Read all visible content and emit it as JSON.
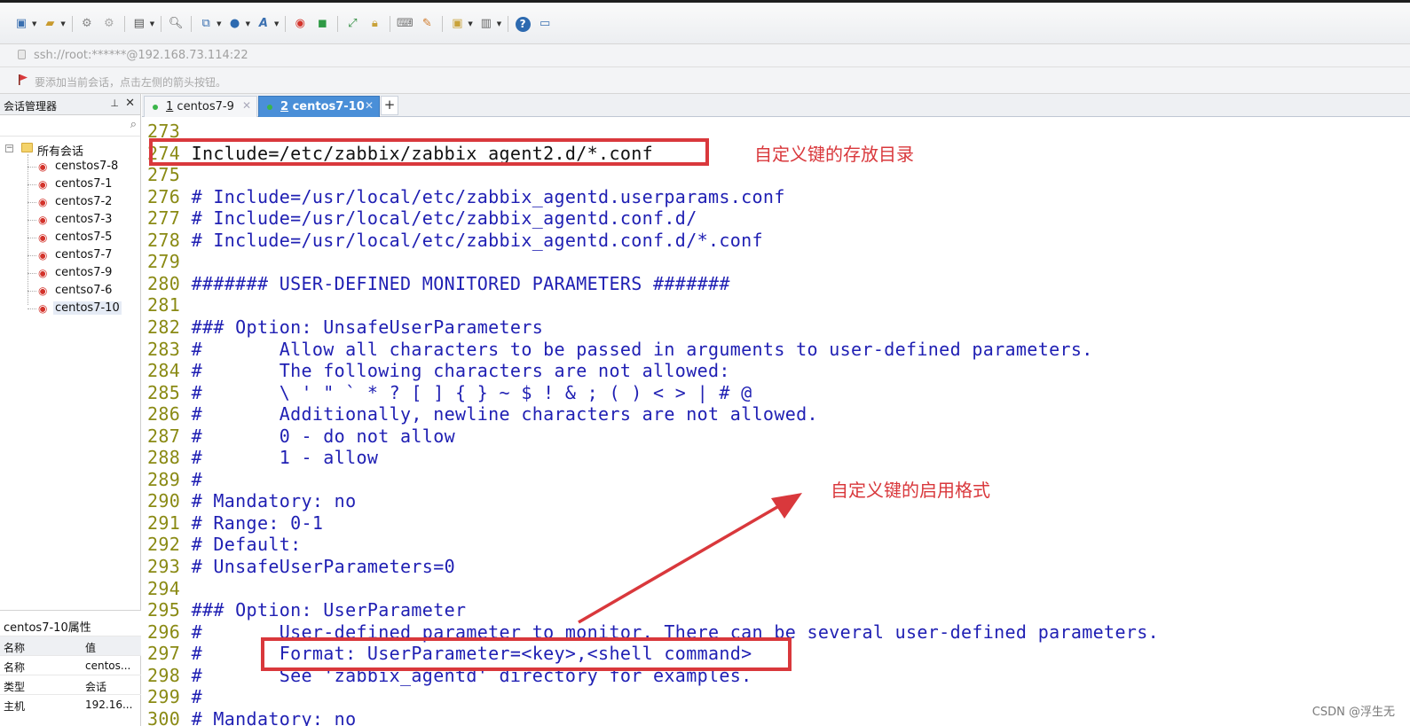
{
  "toolbar": {
    "icons": [
      "new-session-icon",
      "open-folder-icon",
      "connect-icon",
      "disconnect-icon",
      "session-layout-icon",
      "find-icon",
      "copy-paste-icon",
      "globe-icon",
      "font-icon",
      "xftp-icon",
      "xshell-icon",
      "fullscreen-icon",
      "lock-icon",
      "keyboard-icon",
      "highlight-icon",
      "compose-icon",
      "layout-icon",
      "help-icon",
      "chat-icon"
    ]
  },
  "address": {
    "text": "ssh://root:******@192.168.73.114:22"
  },
  "hint": {
    "text": "要添加当前会话，点击左侧的箭头按钮。"
  },
  "sidebar": {
    "title": "会话管理器",
    "root_label": "所有会话",
    "items": [
      "censtos7-8",
      "centos7-1",
      "centos7-2",
      "centos7-3",
      "centos7-5",
      "centos7-7",
      "centos7-9",
      "centso7-6",
      "centos7-10"
    ],
    "selected": "centos7-10"
  },
  "properties": {
    "title": "centos7-10属性",
    "col_name": "名称",
    "col_value": "值",
    "rows": [
      {
        "k": "名称",
        "v": "centos..."
      },
      {
        "k": "类型",
        "v": "会话"
      },
      {
        "k": "主机",
        "v": "192.16..."
      }
    ]
  },
  "tabs": [
    {
      "num": "1",
      "name": "centos7-9"
    },
    {
      "num": "2",
      "name": "centos7-10"
    }
  ],
  "terminal": {
    "lines": [
      {
        "n": "273",
        "t": ""
      },
      {
        "n": "274",
        "t": "Include=/etc/zabbix/zabbix_agent2.d/*.conf"
      },
      {
        "n": "275",
        "t": ""
      },
      {
        "n": "276",
        "t": "# Include=/usr/local/etc/zabbix_agentd.userparams.conf"
      },
      {
        "n": "277",
        "t": "# Include=/usr/local/etc/zabbix_agentd.conf.d/"
      },
      {
        "n": "278",
        "t": "# Include=/usr/local/etc/zabbix_agentd.conf.d/*.conf"
      },
      {
        "n": "279",
        "t": ""
      },
      {
        "n": "280",
        "t": "####### USER-DEFINED MONITORED PARAMETERS #######"
      },
      {
        "n": "281",
        "t": ""
      },
      {
        "n": "282",
        "t": "### Option: UnsafeUserParameters"
      },
      {
        "n": "283",
        "t": "#       Allow all characters to be passed in arguments to user-defined parameters."
      },
      {
        "n": "284",
        "t": "#       The following characters are not allowed:"
      },
      {
        "n": "285",
        "t": "#       \\ ' \" ` * ? [ ] { } ~ $ ! & ; ( ) < > | # @"
      },
      {
        "n": "286",
        "t": "#       Additionally, newline characters are not allowed."
      },
      {
        "n": "287",
        "t": "#       0 - do not allow"
      },
      {
        "n": "288",
        "t": "#       1 - allow"
      },
      {
        "n": "289",
        "t": "#"
      },
      {
        "n": "290",
        "t": "# Mandatory: no"
      },
      {
        "n": "291",
        "t": "# Range: 0-1"
      },
      {
        "n": "292",
        "t": "# Default:"
      },
      {
        "n": "293",
        "t": "# UnsafeUserParameters=0"
      },
      {
        "n": "294",
        "t": ""
      },
      {
        "n": "295",
        "t": "### Option: UserParameter"
      },
      {
        "n": "296",
        "t": "#       User-defined parameter to monitor. There can be several user-defined parameters."
      },
      {
        "n": "297",
        "t": "#       Format: UserParameter=<key>,<shell command>"
      },
      {
        "n": "298",
        "t": "#       See 'zabbix_agentd' directory for examples."
      },
      {
        "n": "299",
        "t": "#"
      },
      {
        "n": "300",
        "t": "# Mandatory: no"
      }
    ]
  },
  "annotations": {
    "key_dir": "自定义键的存放目录",
    "key_format": "自定义键的启用格式",
    "color": "#d9383c"
  },
  "watermark": "CSDN @浮生无"
}
